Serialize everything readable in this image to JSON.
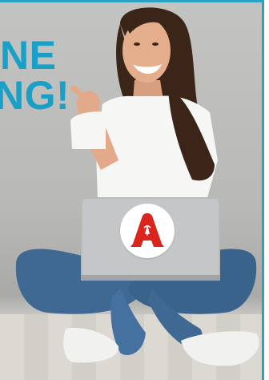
{
  "headline": {
    "line1": "NE",
    "line2": "NG!"
  },
  "colors": {
    "accent": "#1aa0c6",
    "border": "#2aa3c2",
    "logo_red": "#d9251d"
  },
  "logo": {
    "icon": "apotheke-a-icon"
  }
}
